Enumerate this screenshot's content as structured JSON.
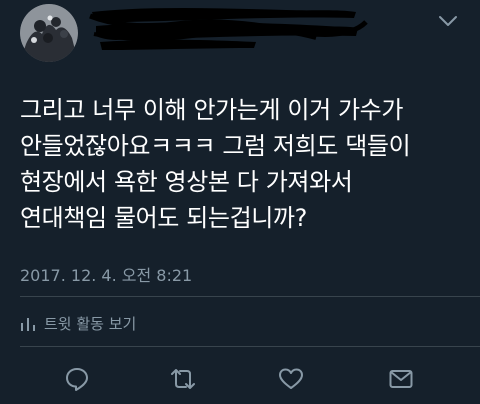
{
  "tweet": {
    "body_lines": [
      "그리고 너무 이해 안가는게 이거 가수가",
      "안들었잖아요ㅋㅋㅋ 그럼 저희도 댁들이",
      "현장에서 욕한 영상본 다 가져와서",
      "연대책임 물어도 되는겁니까?"
    ],
    "timestamp": "2017. 12. 4. 오전 8:21",
    "activity_label": "트윗 활동 보기"
  },
  "icons": {
    "more": "chevron-down-icon",
    "reply": "reply-icon",
    "retweet": "retweet-icon",
    "like": "heart-icon",
    "message": "envelope-icon",
    "activity": "bar-chart-icon"
  },
  "colors": {
    "background": "#15202b",
    "text": "#ffffff",
    "secondary": "#8899a6",
    "divider": "#38444d"
  }
}
